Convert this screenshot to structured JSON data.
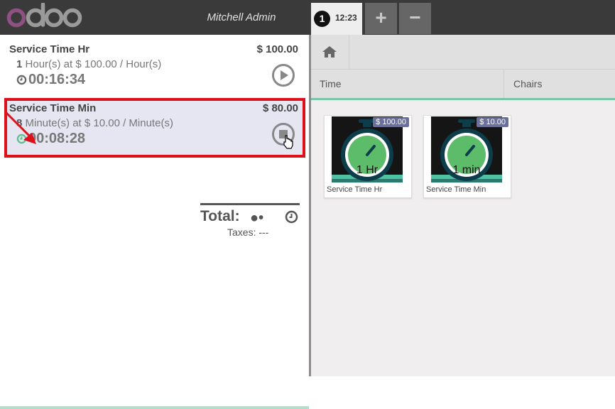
{
  "header": {
    "user_name": "Mitchell Admin",
    "order": {
      "number": "1",
      "time": "12:23"
    },
    "add_label": "+",
    "remove_label": "−"
  },
  "order_lines": [
    {
      "name": "Service Time Hr",
      "price": "$ 100.00",
      "qty": "1",
      "unit_text": "Hour(s) at $ 100.00 / Hour(s)",
      "elapsed": "00:16:34",
      "state": "paused",
      "selected": false
    },
    {
      "name": "Service Time Min",
      "price": "$ 80.00",
      "qty": "8",
      "unit_text": "Minute(s) at $ 10.00 / Minute(s)",
      "elapsed": "00:08:28",
      "state": "running",
      "selected": true
    }
  ],
  "totals": {
    "label": "Total:",
    "value": "●•",
    "taxes": "Taxes: ---"
  },
  "categories": [
    "Time",
    "Chairs"
  ],
  "products": [
    {
      "name": "Service Time Hr",
      "price_tag": "$ 100.00",
      "image_text": "1 Hr"
    },
    {
      "name": "Service Time Min",
      "price_tag": "$ 10.00",
      "image_text": "1 min"
    }
  ],
  "colors": {
    "accent": "#7ac5a7",
    "highlight_border": "#e0101a",
    "brand": "#875a7b",
    "header_bg": "#3a3a3a"
  }
}
